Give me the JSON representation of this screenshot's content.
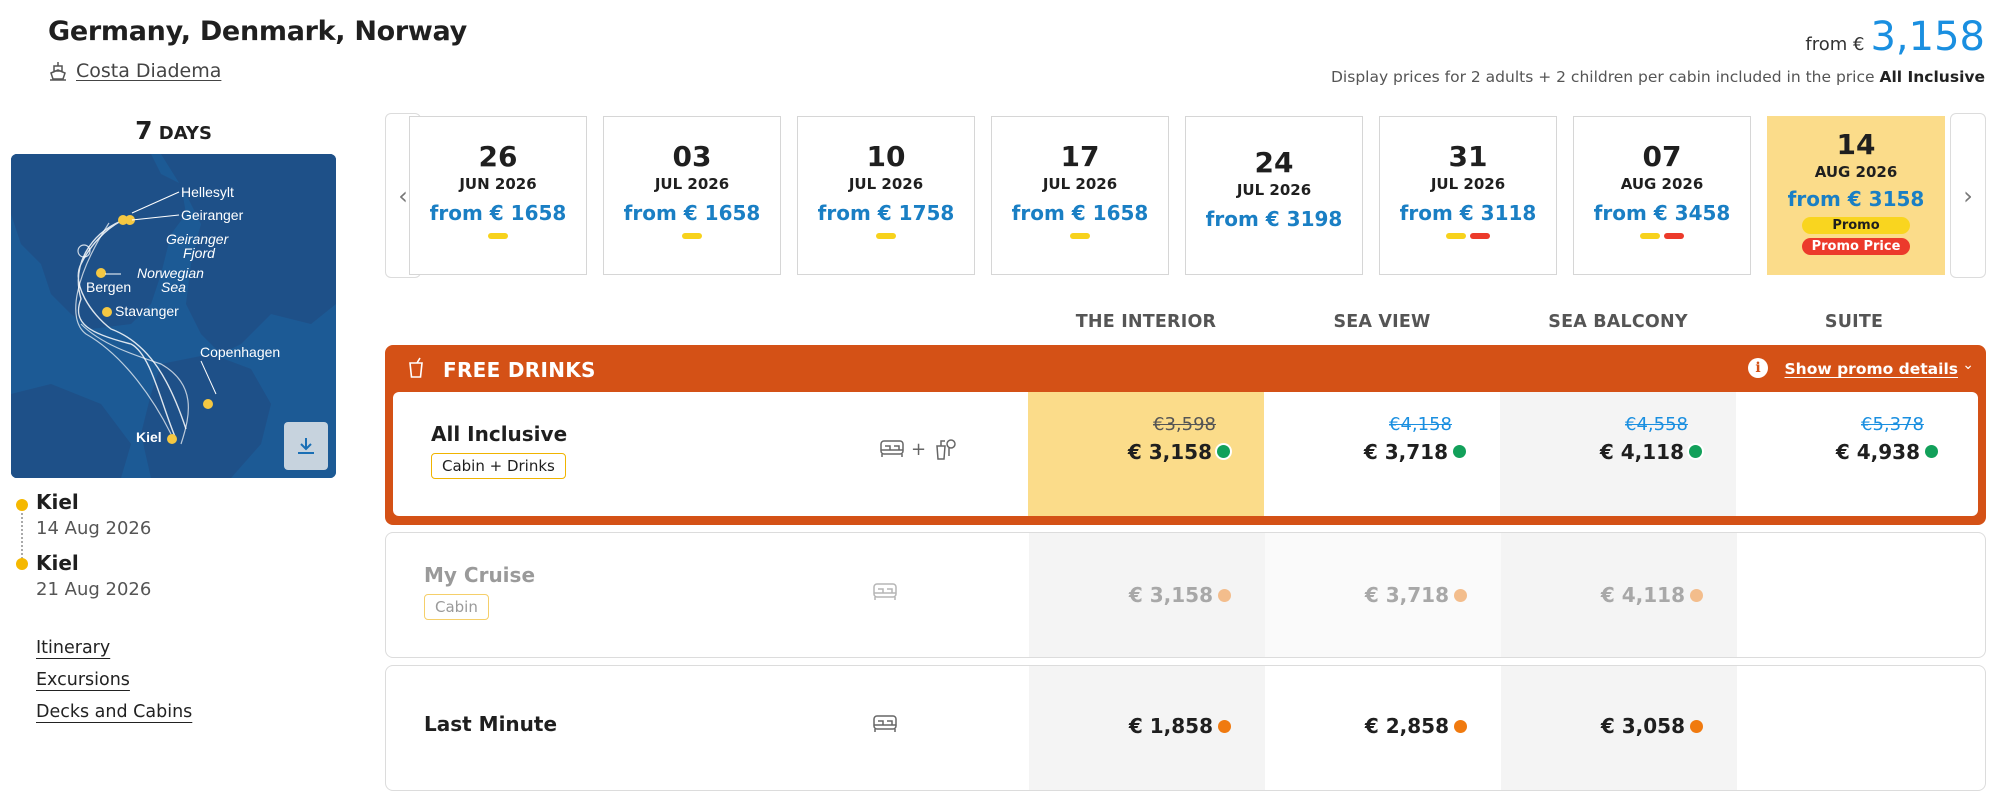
{
  "header": {
    "title": "Germany, Denmark, Norway",
    "ship": "Costa Diadema",
    "from_label": "from €",
    "from_price": "3,158",
    "note_prefix": "Display prices for 2 adults + 2 children per cabin included in the price ",
    "note_bold": "All Inclusive"
  },
  "left": {
    "days_number": "7",
    "days_label": "DAYS",
    "map_labels": [
      "Hellesylt",
      "Geiranger",
      "Geiranger",
      "Fjord",
      "Norwegian",
      "Sea",
      "Bergen",
      "Stavanger",
      "Copenhagen",
      "Kiel"
    ],
    "stops": [
      {
        "name": "Kiel",
        "date": "14 Aug 2026"
      },
      {
        "name": "Kiel",
        "date": "21 Aug 2026"
      }
    ],
    "links": [
      "Itinerary",
      "Excursions",
      "Decks and Cabins"
    ]
  },
  "dates": [
    {
      "day": "26",
      "month": "JUN 2026",
      "price": "from € 1658",
      "tags": [
        "yellow"
      ]
    },
    {
      "day": "03",
      "month": "JUL 2026",
      "price": "from € 1658",
      "tags": [
        "yellow"
      ]
    },
    {
      "day": "10",
      "month": "JUL 2026",
      "price": "from € 1758",
      "tags": [
        "yellow"
      ]
    },
    {
      "day": "17",
      "month": "JUL 2026",
      "price": "from € 1658",
      "tags": [
        "yellow"
      ]
    },
    {
      "day": "24",
      "month": "JUL 2026",
      "price": "from € 3198",
      "tags": []
    },
    {
      "day": "31",
      "month": "JUL 2026",
      "price": "from € 3118",
      "tags": [
        "yellow",
        "red"
      ]
    },
    {
      "day": "07",
      "month": "AUG 2026",
      "price": "from € 3458",
      "tags": [
        "yellow",
        "red"
      ]
    },
    {
      "day": "14",
      "month": "AUG 2026",
      "price": "from € 3158",
      "selected": true,
      "promo": "Promo",
      "promo_price": "Promo Price"
    }
  ],
  "columns": [
    "THE INTERIOR",
    "SEA VIEW",
    "SEA BALCONY",
    "SUITE"
  ],
  "promo": {
    "title": "FREE DRINKS",
    "info": "i",
    "link": "Show promo details"
  },
  "fares": [
    {
      "name": "All Inclusive",
      "badge": "Cabin + Drinks",
      "plus": "+",
      "prices": [
        {
          "was": "€3,598",
          "now": "€ 3,158"
        },
        {
          "was": "€4,158",
          "now": "€ 3,718"
        },
        {
          "was": "€4,558",
          "now": "€ 4,118"
        },
        {
          "was": "€5,378",
          "now": "€ 4,938"
        }
      ]
    },
    {
      "name": "My Cruise",
      "badge": "Cabin",
      "prices": [
        {
          "now": "€ 3,158"
        },
        {
          "now": "€ 3,718"
        },
        {
          "now": "€ 4,118"
        }
      ]
    },
    {
      "name": "Last Minute",
      "prices": [
        {
          "now": "€ 1,858"
        },
        {
          "now": "€ 2,858"
        },
        {
          "now": "€ 3,058"
        }
      ]
    }
  ],
  "colors": {
    "accent_blue": "#1a8fe0",
    "promo_orange": "#d45116",
    "selected_yellow": "#fbdc8a",
    "tag_yellow": "#f7d21c",
    "tag_red": "#ec3a2b",
    "available_green": "#12a05a",
    "dot_peach": "#f3bd8c",
    "dot_orange": "#f07a0f"
  },
  "icons": [
    "ship-icon",
    "map-download-icon",
    "chevron-left-icon",
    "chevron-right-icon",
    "drink-cup-icon",
    "info-icon",
    "chevron-down-icon",
    "bed-icon",
    "drinks-icon"
  ]
}
